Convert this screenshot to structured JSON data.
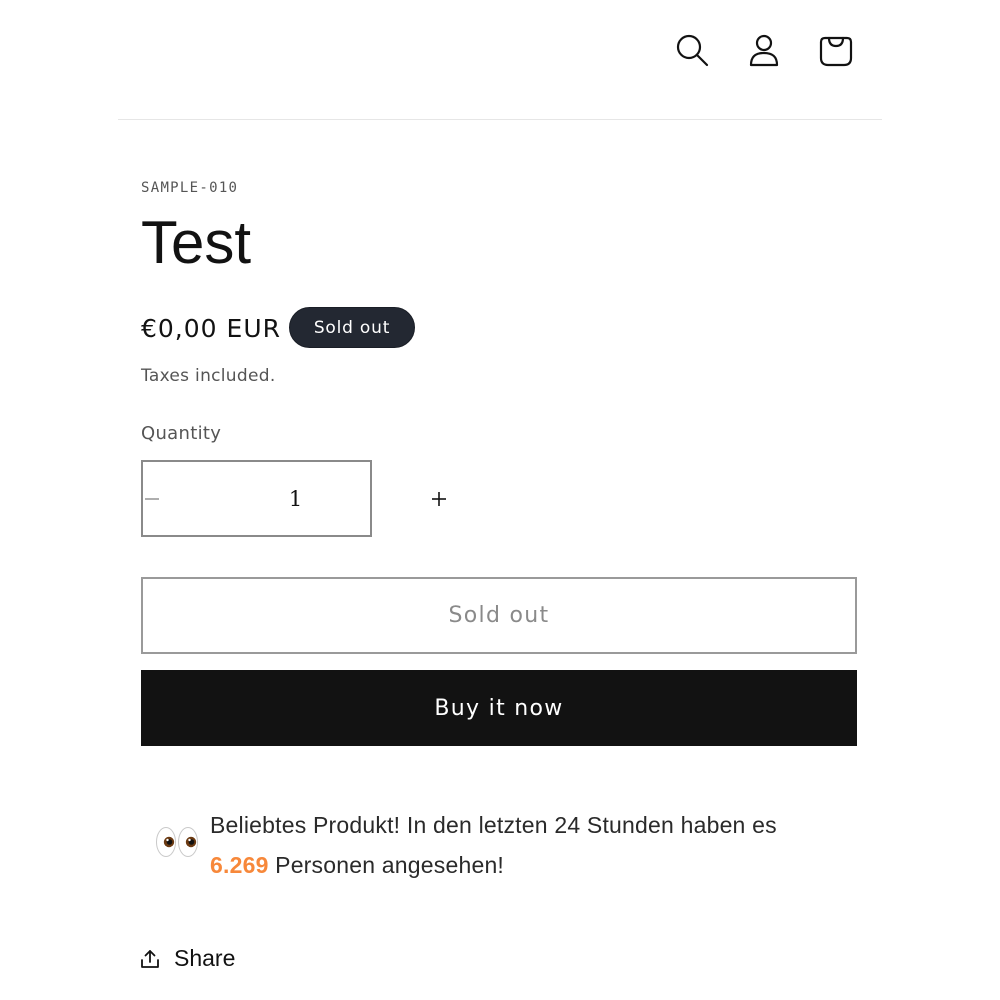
{
  "header": {
    "icons": [
      "search-icon",
      "account-icon",
      "cart-icon"
    ]
  },
  "product": {
    "vendor": "SAMPLE-010",
    "title": "Test",
    "price": "€0,00 EUR",
    "badge": "Sold out",
    "tax_note": "Taxes included."
  },
  "quantity": {
    "label": "Quantity",
    "value": "1",
    "decrease_icon": "minus-icon",
    "increase_icon": "plus-icon"
  },
  "buttons": {
    "add_to_cart": "Sold out",
    "buy_now": "Buy it now"
  },
  "notice": {
    "icon": "eyes-emoji-icon",
    "text_before": "Beliebtes Produkt! In den letzten 24 Stunden haben es",
    "count": "6.269",
    "text_after": " Personen angesehen!",
    "count_color": "#f7883a"
  },
  "share": {
    "icon": "share-icon",
    "label": "Share"
  },
  "colors": {
    "badge_bg": "#232832",
    "buy_button_bg": "#121212",
    "text": "#121212"
  }
}
